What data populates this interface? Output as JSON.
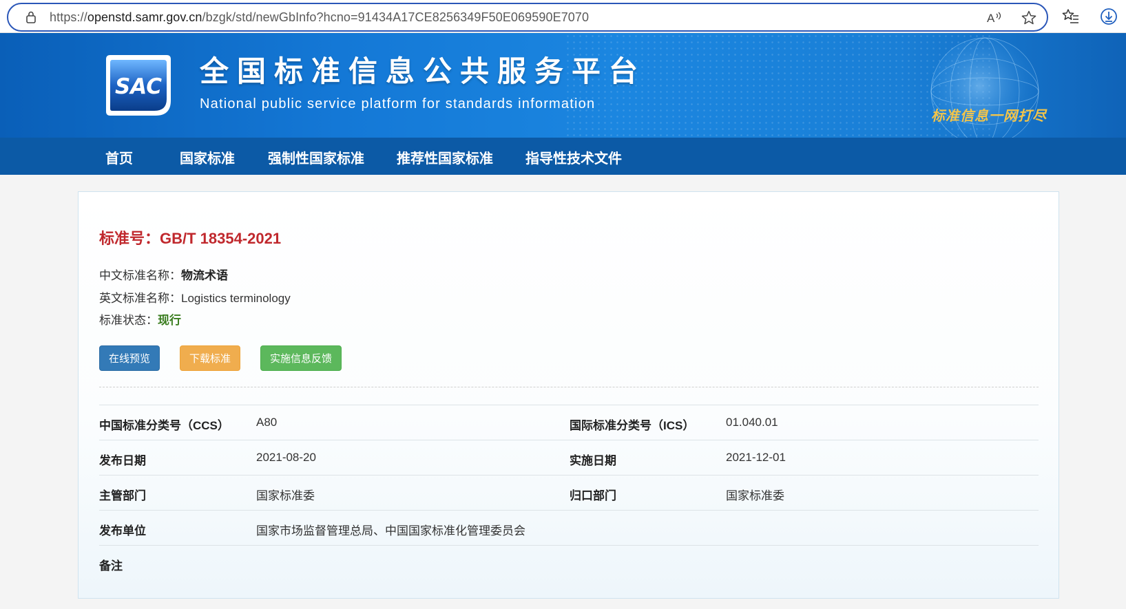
{
  "browser": {
    "url_prefix": "https://",
    "url_domain": "openstd.samr.gov.cn",
    "url_path": "/bzgk/std/newGbInfo?hcno=91434A17CE8256349F50E069590E7070"
  },
  "banner": {
    "logo_text": "SAC",
    "title": "全国标准信息公共服务平台",
    "subtitle": "National public service platform  for standards information",
    "slogan": "标准信息一网打尽"
  },
  "nav": {
    "items": [
      "首页",
      "国家标准",
      "强制性国家标准",
      "推荐性国家标准",
      "指导性技术文件"
    ]
  },
  "standard": {
    "number_label": "标准号：",
    "number": "GB/T 18354-2021",
    "cn_name_label": "中文标准名称：",
    "cn_name": "物流术语",
    "en_name_label": "英文标准名称：",
    "en_name": "Logistics terminology",
    "status_label": "标准状态：",
    "status": "现行"
  },
  "buttons": {
    "preview": "在线预览",
    "download": "下载标准",
    "feedback": "实施信息反馈"
  },
  "details": {
    "ccs_label": "中国标准分类号（CCS）",
    "ccs": "A80",
    "ics_label": "国际标准分类号（ICS）",
    "ics": "01.040.01",
    "publish_date_label": "发布日期",
    "publish_date": "2021-08-20",
    "impl_date_label": "实施日期",
    "impl_date": "2021-12-01",
    "dept_label": "主管部门",
    "dept": "国家标准委",
    "belong_label": "归口部门",
    "belong": "国家标准委",
    "publisher_label": "发布单位",
    "publisher": "国家市场监督管理总局、中国国家标准化管理委员会",
    "remark_label": "备注",
    "remark": ""
  },
  "colors": {
    "banner": "#1478d6",
    "nav": "#0c5aa6",
    "std_number": "#c0282d",
    "status": "#3a7d1f",
    "btn_blue": "#337ab7",
    "btn_orange": "#f0ad4e",
    "btn_green": "#5cb85c"
  }
}
